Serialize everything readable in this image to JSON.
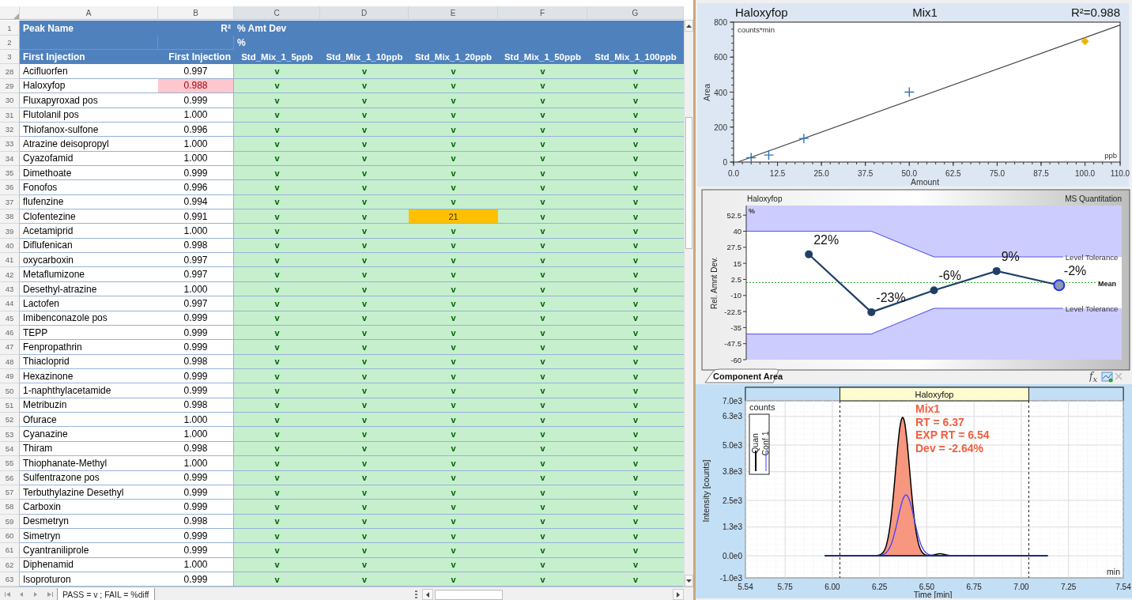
{
  "sheet": {
    "column_headers": [
      "A",
      "B",
      "C",
      "D",
      "E",
      "F",
      "G"
    ],
    "header_rows": [
      {
        "number": "1",
        "a": "Peak Name",
        "b": "R²",
        "span": "% Amt Dev"
      },
      {
        "number": "2",
        "span": "%"
      },
      {
        "number": "3",
        "a": "First Injection",
        "b": "First Injection",
        "columns": [
          "Std_Mix_1_5ppb",
          "Std_Mix_1_10ppb",
          "Std_Mix_1_20ppb",
          "Std_Mix_1_50ppb",
          "Std_Mix_1_100ppb"
        ]
      }
    ],
    "rows": [
      {
        "number": "28",
        "name": "Acifluorfen",
        "r2": "0.997",
        "r2_fail": false,
        "cells": [
          {
            "text": "v",
            "fail": false
          },
          {
            "text": "v",
            "fail": false
          },
          {
            "text": "v",
            "fail": false
          },
          {
            "text": "v",
            "fail": false
          },
          {
            "text": "v",
            "fail": false
          }
        ]
      },
      {
        "number": "29",
        "name": "Haloxyfop",
        "r2": "0.988",
        "r2_fail": true,
        "cells": [
          {
            "text": "v",
            "fail": false
          },
          {
            "text": "v",
            "fail": false
          },
          {
            "text": "v",
            "fail": false
          },
          {
            "text": "v",
            "fail": false
          },
          {
            "text": "v",
            "fail": false
          }
        ]
      },
      {
        "number": "30",
        "name": "Fluxapyroxad pos",
        "r2": "0.999",
        "r2_fail": false,
        "cells": [
          {
            "text": "v",
            "fail": false
          },
          {
            "text": "v",
            "fail": false
          },
          {
            "text": "v",
            "fail": false
          },
          {
            "text": "v",
            "fail": false
          },
          {
            "text": "v",
            "fail": false
          }
        ]
      },
      {
        "number": "31",
        "name": "Flutolanil pos",
        "r2": "1.000",
        "r2_fail": false,
        "cells": [
          {
            "text": "v",
            "fail": false
          },
          {
            "text": "v",
            "fail": false
          },
          {
            "text": "v",
            "fail": false
          },
          {
            "text": "v",
            "fail": false
          },
          {
            "text": "v",
            "fail": false
          }
        ]
      },
      {
        "number": "32",
        "name": "Thiofanox-sulfone",
        "r2": "0.996",
        "r2_fail": false,
        "cells": [
          {
            "text": "v",
            "fail": false
          },
          {
            "text": "v",
            "fail": false
          },
          {
            "text": "v",
            "fail": false
          },
          {
            "text": "v",
            "fail": false
          },
          {
            "text": "v",
            "fail": false
          }
        ]
      },
      {
        "number": "33",
        "name": "Atrazine deisopropyl",
        "r2": "1.000",
        "r2_fail": false,
        "cells": [
          {
            "text": "v",
            "fail": false
          },
          {
            "text": "v",
            "fail": false
          },
          {
            "text": "v",
            "fail": false
          },
          {
            "text": "v",
            "fail": false
          },
          {
            "text": "v",
            "fail": false
          }
        ]
      },
      {
        "number": "34",
        "name": "Cyazofamid",
        "r2": "1.000",
        "r2_fail": false,
        "cells": [
          {
            "text": "v",
            "fail": false
          },
          {
            "text": "v",
            "fail": false
          },
          {
            "text": "v",
            "fail": false
          },
          {
            "text": "v",
            "fail": false
          },
          {
            "text": "v",
            "fail": false
          }
        ]
      },
      {
        "number": "35",
        "name": "Dimethoate",
        "r2": "0.999",
        "r2_fail": false,
        "cells": [
          {
            "text": "v",
            "fail": false
          },
          {
            "text": "v",
            "fail": false
          },
          {
            "text": "v",
            "fail": false
          },
          {
            "text": "v",
            "fail": false
          },
          {
            "text": "v",
            "fail": false
          }
        ]
      },
      {
        "number": "36",
        "name": "Fonofos",
        "r2": "0.996",
        "r2_fail": false,
        "cells": [
          {
            "text": "v",
            "fail": false
          },
          {
            "text": "v",
            "fail": false
          },
          {
            "text": "v",
            "fail": false
          },
          {
            "text": "v",
            "fail": false
          },
          {
            "text": "v",
            "fail": false
          }
        ]
      },
      {
        "number": "37",
        "name": "flufenzine",
        "r2": "0.994",
        "r2_fail": false,
        "cells": [
          {
            "text": "v",
            "fail": false
          },
          {
            "text": "v",
            "fail": false
          },
          {
            "text": "v",
            "fail": false
          },
          {
            "text": "v",
            "fail": false
          },
          {
            "text": "v",
            "fail": false
          }
        ]
      },
      {
        "number": "38",
        "name": "Clofentezine",
        "r2": "0.991",
        "r2_fail": false,
        "cells": [
          {
            "text": "v",
            "fail": false
          },
          {
            "text": "v",
            "fail": false
          },
          {
            "text": "21",
            "fail": true
          },
          {
            "text": "v",
            "fail": false
          },
          {
            "text": "v",
            "fail": false
          }
        ]
      },
      {
        "number": "39",
        "name": "Acetamiprid",
        "r2": "1.000",
        "r2_fail": false,
        "cells": [
          {
            "text": "v",
            "fail": false
          },
          {
            "text": "v",
            "fail": false
          },
          {
            "text": "v",
            "fail": false
          },
          {
            "text": "v",
            "fail": false
          },
          {
            "text": "v",
            "fail": false
          }
        ]
      },
      {
        "number": "40",
        "name": "Diflufenican",
        "r2": "0.998",
        "r2_fail": false,
        "cells": [
          {
            "text": "v",
            "fail": false
          },
          {
            "text": "v",
            "fail": false
          },
          {
            "text": "v",
            "fail": false
          },
          {
            "text": "v",
            "fail": false
          },
          {
            "text": "v",
            "fail": false
          }
        ]
      },
      {
        "number": "41",
        "name": "oxycarboxin",
        "r2": "0.997",
        "r2_fail": false,
        "cells": [
          {
            "text": "v",
            "fail": false
          },
          {
            "text": "v",
            "fail": false
          },
          {
            "text": "v",
            "fail": false
          },
          {
            "text": "v",
            "fail": false
          },
          {
            "text": "v",
            "fail": false
          }
        ]
      },
      {
        "number": "42",
        "name": "Metaflumizone",
        "r2": "0.997",
        "r2_fail": false,
        "cells": [
          {
            "text": "v",
            "fail": false
          },
          {
            "text": "v",
            "fail": false
          },
          {
            "text": "v",
            "fail": false
          },
          {
            "text": "v",
            "fail": false
          },
          {
            "text": "v",
            "fail": false
          }
        ]
      },
      {
        "number": "43",
        "name": "Desethyl-atrazine",
        "r2": "1.000",
        "r2_fail": false,
        "cells": [
          {
            "text": "v",
            "fail": false
          },
          {
            "text": "v",
            "fail": false
          },
          {
            "text": "v",
            "fail": false
          },
          {
            "text": "v",
            "fail": false
          },
          {
            "text": "v",
            "fail": false
          }
        ]
      },
      {
        "number": "44",
        "name": "Lactofen",
        "r2": "0.997",
        "r2_fail": false,
        "cells": [
          {
            "text": "v",
            "fail": false
          },
          {
            "text": "v",
            "fail": false
          },
          {
            "text": "v",
            "fail": false
          },
          {
            "text": "v",
            "fail": false
          },
          {
            "text": "v",
            "fail": false
          }
        ]
      },
      {
        "number": "45",
        "name": "Imibenconazole pos",
        "r2": "0.999",
        "r2_fail": false,
        "cells": [
          {
            "text": "v",
            "fail": false
          },
          {
            "text": "v",
            "fail": false
          },
          {
            "text": "v",
            "fail": false
          },
          {
            "text": "v",
            "fail": false
          },
          {
            "text": "v",
            "fail": false
          }
        ]
      },
      {
        "number": "46",
        "name": "TEPP",
        "r2": "0.999",
        "r2_fail": false,
        "cells": [
          {
            "text": "v",
            "fail": false
          },
          {
            "text": "v",
            "fail": false
          },
          {
            "text": "v",
            "fail": false
          },
          {
            "text": "v",
            "fail": false
          },
          {
            "text": "v",
            "fail": false
          }
        ]
      },
      {
        "number": "47",
        "name": "Fenpropathrin",
        "r2": "0.999",
        "r2_fail": false,
        "cells": [
          {
            "text": "v",
            "fail": false
          },
          {
            "text": "v",
            "fail": false
          },
          {
            "text": "v",
            "fail": false
          },
          {
            "text": "v",
            "fail": false
          },
          {
            "text": "v",
            "fail": false
          }
        ]
      },
      {
        "number": "48",
        "name": "Thiacloprid",
        "r2": "0.998",
        "r2_fail": false,
        "cells": [
          {
            "text": "v",
            "fail": false
          },
          {
            "text": "v",
            "fail": false
          },
          {
            "text": "v",
            "fail": false
          },
          {
            "text": "v",
            "fail": false
          },
          {
            "text": "v",
            "fail": false
          }
        ]
      },
      {
        "number": "49",
        "name": "Hexazinone",
        "r2": "0.999",
        "r2_fail": false,
        "cells": [
          {
            "text": "v",
            "fail": false
          },
          {
            "text": "v",
            "fail": false
          },
          {
            "text": "v",
            "fail": false
          },
          {
            "text": "v",
            "fail": false
          },
          {
            "text": "v",
            "fail": false
          }
        ]
      },
      {
        "number": "50",
        "name": "1-naphthylacetamide",
        "r2": "0.999",
        "r2_fail": false,
        "cells": [
          {
            "text": "v",
            "fail": false
          },
          {
            "text": "v",
            "fail": false
          },
          {
            "text": "v",
            "fail": false
          },
          {
            "text": "v",
            "fail": false
          },
          {
            "text": "v",
            "fail": false
          }
        ]
      },
      {
        "number": "51",
        "name": "Metribuzin",
        "r2": "0.998",
        "r2_fail": false,
        "cells": [
          {
            "text": "v",
            "fail": false
          },
          {
            "text": "v",
            "fail": false
          },
          {
            "text": "v",
            "fail": false
          },
          {
            "text": "v",
            "fail": false
          },
          {
            "text": "v",
            "fail": false
          }
        ]
      },
      {
        "number": "52",
        "name": "Ofurace",
        "r2": "1.000",
        "r2_fail": false,
        "cells": [
          {
            "text": "v",
            "fail": false
          },
          {
            "text": "v",
            "fail": false
          },
          {
            "text": "v",
            "fail": false
          },
          {
            "text": "v",
            "fail": false
          },
          {
            "text": "v",
            "fail": false
          }
        ]
      },
      {
        "number": "53",
        "name": "Cyanazine",
        "r2": "1.000",
        "r2_fail": false,
        "cells": [
          {
            "text": "v",
            "fail": false
          },
          {
            "text": "v",
            "fail": false
          },
          {
            "text": "v",
            "fail": false
          },
          {
            "text": "v",
            "fail": false
          },
          {
            "text": "v",
            "fail": false
          }
        ]
      },
      {
        "number": "54",
        "name": "Thiram",
        "r2": "0.998",
        "r2_fail": false,
        "cells": [
          {
            "text": "v",
            "fail": false
          },
          {
            "text": "v",
            "fail": false
          },
          {
            "text": "v",
            "fail": false
          },
          {
            "text": "v",
            "fail": false
          },
          {
            "text": "v",
            "fail": false
          }
        ]
      },
      {
        "number": "55",
        "name": "Thiophanate-Methyl",
        "r2": "1.000",
        "r2_fail": false,
        "cells": [
          {
            "text": "v",
            "fail": false
          },
          {
            "text": "v",
            "fail": false
          },
          {
            "text": "v",
            "fail": false
          },
          {
            "text": "v",
            "fail": false
          },
          {
            "text": "v",
            "fail": false
          }
        ]
      },
      {
        "number": "56",
        "name": "Sulfentrazone pos",
        "r2": "0.999",
        "r2_fail": false,
        "cells": [
          {
            "text": "v",
            "fail": false
          },
          {
            "text": "v",
            "fail": false
          },
          {
            "text": "v",
            "fail": false
          },
          {
            "text": "v",
            "fail": false
          },
          {
            "text": "v",
            "fail": false
          }
        ]
      },
      {
        "number": "57",
        "name": "Terbuthylazine Desethyl",
        "r2": "0.999",
        "r2_fail": false,
        "cells": [
          {
            "text": "v",
            "fail": false
          },
          {
            "text": "v",
            "fail": false
          },
          {
            "text": "v",
            "fail": false
          },
          {
            "text": "v",
            "fail": false
          },
          {
            "text": "v",
            "fail": false
          }
        ]
      },
      {
        "number": "58",
        "name": "Carboxin",
        "r2": "0.999",
        "r2_fail": false,
        "cells": [
          {
            "text": "v",
            "fail": false
          },
          {
            "text": "v",
            "fail": false
          },
          {
            "text": "v",
            "fail": false
          },
          {
            "text": "v",
            "fail": false
          },
          {
            "text": "v",
            "fail": false
          }
        ]
      },
      {
        "number": "59",
        "name": "Desmetryn",
        "r2": "0.998",
        "r2_fail": false,
        "cells": [
          {
            "text": "v",
            "fail": false
          },
          {
            "text": "v",
            "fail": false
          },
          {
            "text": "v",
            "fail": false
          },
          {
            "text": "v",
            "fail": false
          },
          {
            "text": "v",
            "fail": false
          }
        ]
      },
      {
        "number": "60",
        "name": "Simetryn",
        "r2": "0.999",
        "r2_fail": false,
        "cells": [
          {
            "text": "v",
            "fail": false
          },
          {
            "text": "v",
            "fail": false
          },
          {
            "text": "v",
            "fail": false
          },
          {
            "text": "v",
            "fail": false
          },
          {
            "text": "v",
            "fail": false
          }
        ]
      },
      {
        "number": "61",
        "name": "Cyantraniliprole",
        "r2": "0.999",
        "r2_fail": false,
        "cells": [
          {
            "text": "v",
            "fail": false
          },
          {
            "text": "v",
            "fail": false
          },
          {
            "text": "v",
            "fail": false
          },
          {
            "text": "v",
            "fail": false
          },
          {
            "text": "v",
            "fail": false
          }
        ]
      },
      {
        "number": "62",
        "name": "Diphenamid",
        "r2": "1.000",
        "r2_fail": false,
        "cells": [
          {
            "text": "v",
            "fail": false
          },
          {
            "text": "v",
            "fail": false
          },
          {
            "text": "v",
            "fail": false
          },
          {
            "text": "v",
            "fail": false
          },
          {
            "text": "v",
            "fail": false
          }
        ]
      },
      {
        "number": "63",
        "name": "Isoproturon",
        "r2": "0.999",
        "r2_fail": false,
        "cells": [
          {
            "text": "v",
            "fail": false
          },
          {
            "text": "v",
            "fail": false
          },
          {
            "text": "v",
            "fail": false
          },
          {
            "text": "v",
            "fail": false
          },
          {
            "text": "v",
            "fail": false
          }
        ]
      }
    ],
    "sheet_tab": {
      "label": "PASS = v ; FAIL = %diff",
      "selected": true
    }
  },
  "calibration_chart": {
    "compound": "Haloxyfop",
    "sample": "Mix1",
    "r2": "R²=0.988",
    "y_unit": "counts*min",
    "x_unit": "ppb",
    "chart_data": {
      "type": "scatter",
      "xlabel": "Amount",
      "ylabel": "Area",
      "x": [
        5,
        10,
        20,
        50,
        100
      ],
      "series": [
        {
          "color": "#2e75b6",
          "values": [
            25,
            40,
            135,
            400,
            null
          ]
        },
        {
          "color": "#f0b400",
          "values": [
            null,
            null,
            null,
            null,
            690
          ]
        }
      ],
      "xlim": [
        0,
        110
      ],
      "ylim": [
        0,
        800
      ],
      "xticks": [
        {
          "value": 0,
          "label": "0.0"
        },
        {
          "value": 12.5,
          "label": "12.5"
        },
        {
          "value": 25,
          "label": "25.0"
        },
        {
          "value": 37.5,
          "label": "37.5"
        },
        {
          "value": 50,
          "label": "50.0"
        },
        {
          "value": 62.5,
          "label": "62.5"
        },
        {
          "value": 75,
          "label": "75.0"
        },
        {
          "value": 87.5,
          "label": "87.5"
        },
        {
          "value": 100,
          "label": "100.0"
        },
        {
          "value": 110,
          "label": "110.0"
        }
      ],
      "yticks": [
        0,
        200,
        400,
        600,
        800
      ]
    }
  },
  "deviation_chart": {
    "compound": "Haloxyfop",
    "mode": "MS Quantitation",
    "y_unit": "%",
    "ylabel": "Rel. Amnt Dev.",
    "yticks": [
      "52.5",
      "40",
      "27.5",
      "15",
      "2.5",
      "-10",
      "-22.5",
      "-35",
      "-47.5",
      "-60"
    ],
    "points": [
      {
        "label": "22%",
        "selected": false
      },
      {
        "label": "-23%",
        "selected": false
      },
      {
        "label": "-6%",
        "selected": false
      },
      {
        "label": "9%",
        "selected": false
      },
      {
        "label": "-2%",
        "selected": true
      }
    ],
    "tolerance_labels": [
      "Level Tolerance",
      "Level Tolerance"
    ],
    "mean_label": "Mean",
    "tab": {
      "label": "Component Area",
      "selected": true
    },
    "formula_button": "f$_{x}$"
  },
  "chromatogram": {
    "compound": "Haloxyfop",
    "annotations": [
      "Mix1",
      "RT = 6.37",
      "EXP RT = 6.54",
      "Dev = -2.64%"
    ],
    "y_unit": "counts",
    "x_unit": "min",
    "xlabel": "Time [min]",
    "ylabel": "Intensity [counts]",
    "xticks": [
      "5.54",
      "5.75",
      "6.00",
      "6.25",
      "6.50",
      "6.75",
      "7.00",
      "7.25",
      "7.54"
    ],
    "yticks": [
      "7.0e3",
      "6.3e3",
      "5.0e3",
      "3.8e3",
      "2.5e3",
      "1.3e3",
      "0.0e0",
      "-1.0e3"
    ],
    "legend": [
      {
        "label": "Quan",
        "color": "#000000"
      },
      {
        "label": "Conf 1",
        "color": "#4040ff"
      }
    ]
  }
}
